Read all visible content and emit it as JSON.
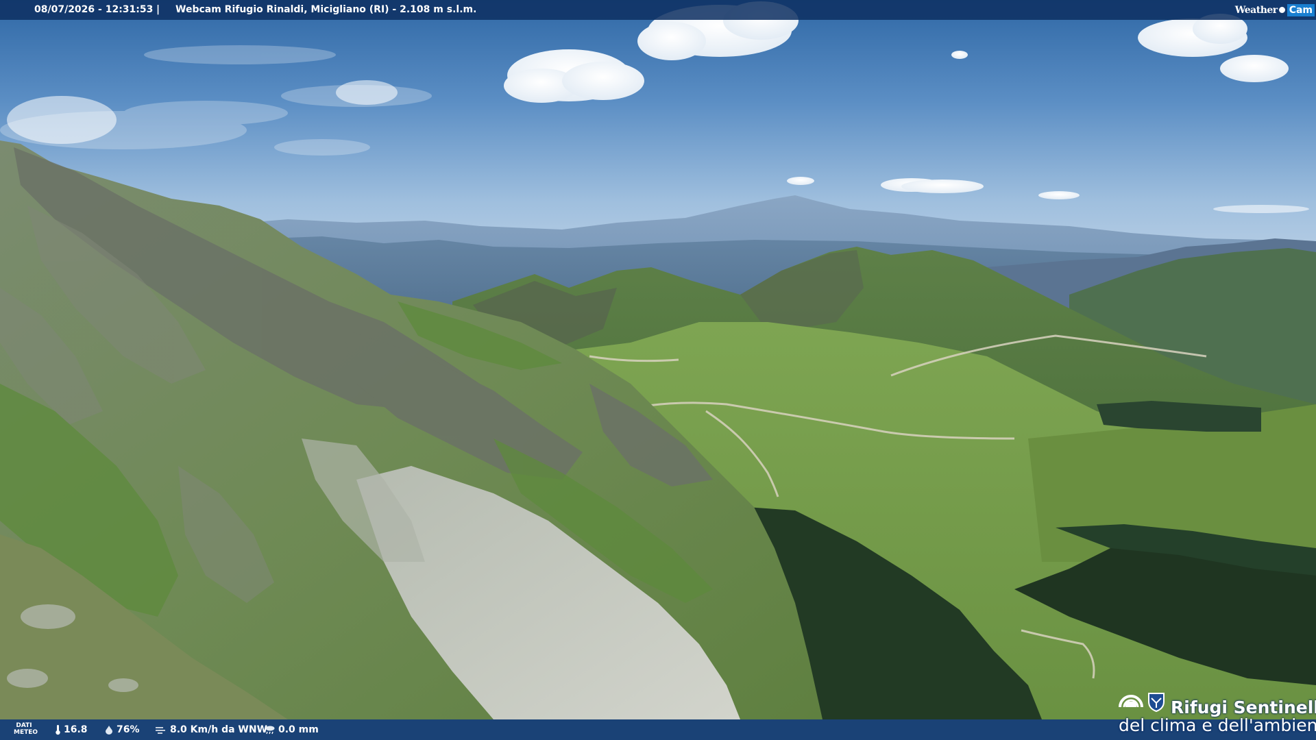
{
  "header": {
    "datetime": "08/07/2026 - 12:31:53",
    "separator": "|",
    "title": "Webcam Rifugio Rinaldi, Micigliano (RI) - 2.108 m s.l.m.",
    "logo_weather": "Weather",
    "logo_cam": "Cam"
  },
  "weather_bar": {
    "label_line1": "DATI",
    "label_line2": "METEO",
    "temperature": "16.8",
    "humidity": "76%",
    "wind": "8.0 Km/h da WNW",
    "rain": "0.0 mm",
    "icons": {
      "temperature": "thermometer-icon",
      "humidity": "droplet-icon",
      "wind": "wind-icon",
      "rain": "rain-icon"
    }
  },
  "sponsor": {
    "line1": "Rifugi Sentinella",
    "line2": "del clima e dell'ambiente",
    "icons": [
      "cnr-logo",
      "cai-shield-logo"
    ]
  },
  "colors": {
    "bar_background": "#0e3062",
    "sky_top": "#3a6fa8",
    "sky_horizon": "#b7cfe4",
    "meadow": "#6f9a45",
    "forest": "#223a24",
    "scree": "#c4c8c2"
  }
}
